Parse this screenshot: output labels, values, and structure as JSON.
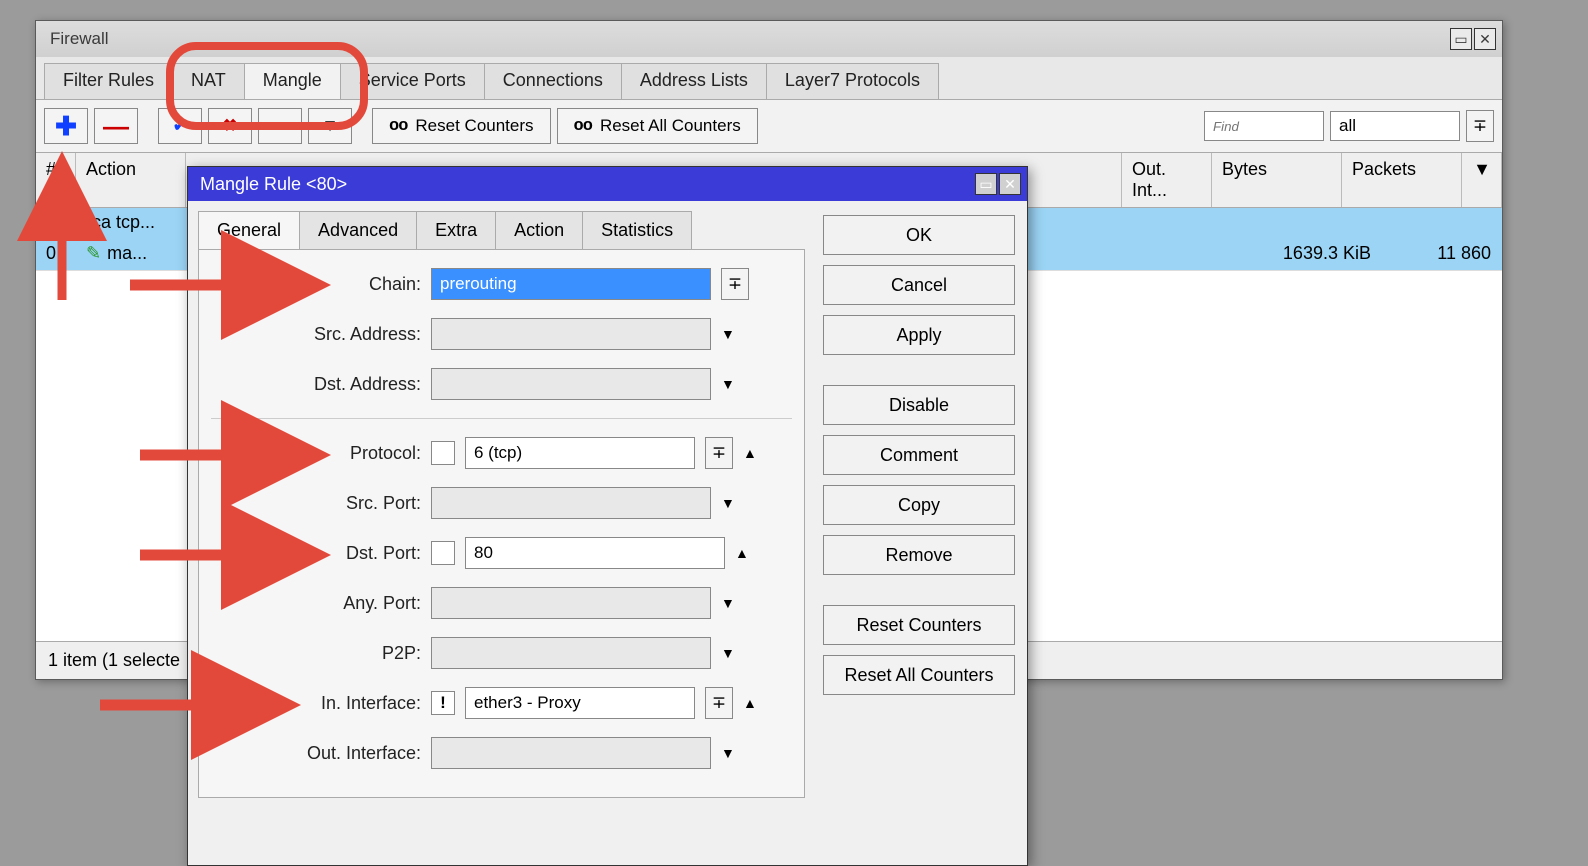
{
  "firewall": {
    "title": "Firewall",
    "tabs": [
      "Filter Rules",
      "NAT",
      "Mangle",
      "Service Ports",
      "Connections",
      "Address Lists",
      "Layer7 Protocols"
    ],
    "active_tab": "Mangle",
    "toolbar": {
      "reset_counters": "Reset Counters",
      "reset_all_counters": "Reset All Counters",
      "find_placeholder": "Find",
      "filter_dd": "all"
    },
    "grid": {
      "headers": {
        "num": "#",
        "action": "Action",
        "out_int": "Out. Int...",
        "bytes": "Bytes",
        "packets": "Packets"
      },
      "comment_row": "::: Artica tcp...",
      "rows": [
        {
          "num": "0",
          "action": "ma...",
          "bytes": "1639.3 KiB",
          "packets": "11 860"
        }
      ]
    },
    "status": "1 item (1 selecte"
  },
  "dialog": {
    "title": "Mangle Rule <80>",
    "tabs": [
      "General",
      "Advanced",
      "Extra",
      "Action",
      "Statistics"
    ],
    "active_tab": "General",
    "fields": {
      "chain": {
        "label": "Chain:",
        "value": "prerouting"
      },
      "src_address": {
        "label": "Src. Address:",
        "value": ""
      },
      "dst_address": {
        "label": "Dst. Address:",
        "value": ""
      },
      "protocol": {
        "label": "Protocol:",
        "value": "6 (tcp)"
      },
      "src_port": {
        "label": "Src. Port:",
        "value": ""
      },
      "dst_port": {
        "label": "Dst. Port:",
        "value": "80"
      },
      "any_port": {
        "label": "Any. Port:",
        "value": ""
      },
      "p2p": {
        "label": "P2P:",
        "value": ""
      },
      "in_interface": {
        "label": "In. Interface:",
        "value": "ether3 - Proxy",
        "neg": "!"
      },
      "out_interface": {
        "label": "Out. Interface:",
        "value": ""
      }
    },
    "buttons": {
      "ok": "OK",
      "cancel": "Cancel",
      "apply": "Apply",
      "disable": "Disable",
      "comment": "Comment",
      "copy": "Copy",
      "remove": "Remove",
      "reset_counters": "Reset Counters",
      "reset_all_counters": "Reset All Counters"
    }
  }
}
